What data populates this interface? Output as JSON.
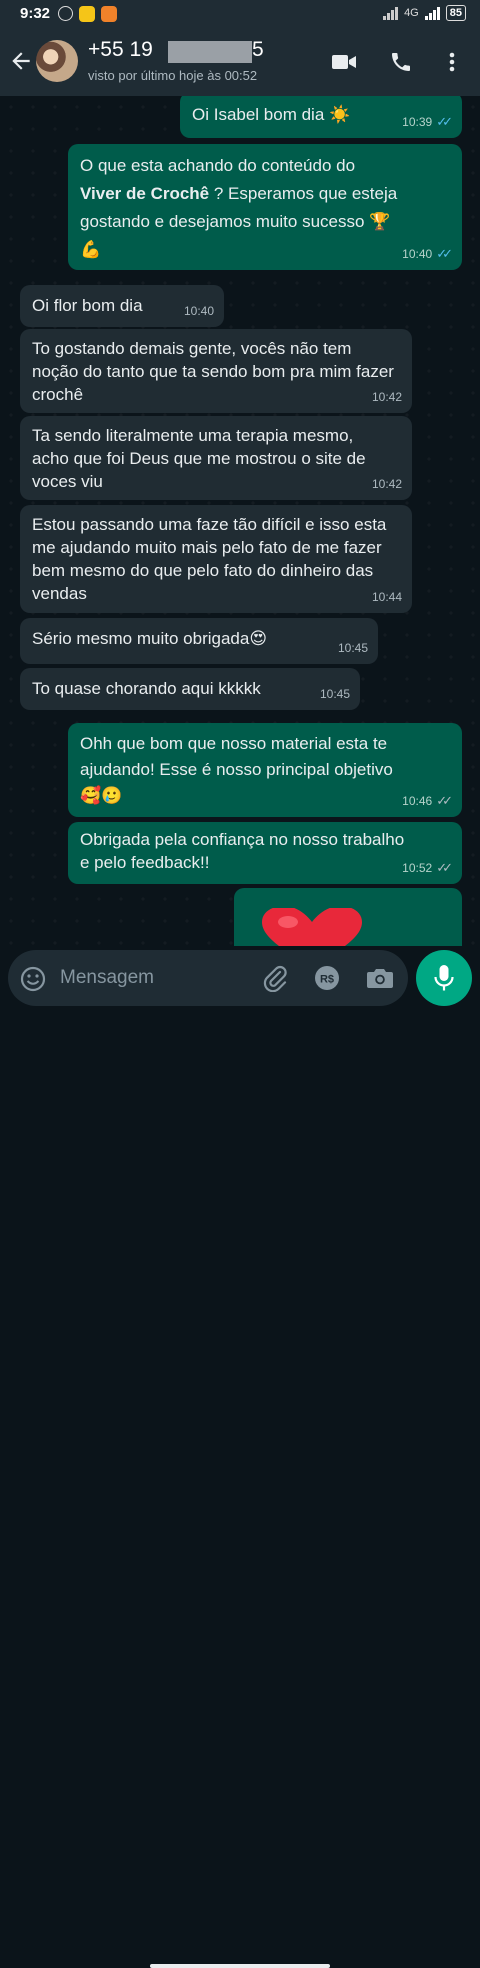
{
  "status_bar": {
    "time": "9:32",
    "battery": "85",
    "network": "4G"
  },
  "header": {
    "contact_name": "+55 19           5665",
    "last_seen": "visto por último hoje às 00:52"
  },
  "messages": [
    {
      "dir": "out",
      "text": "Oi Isabel bom dia ☀️",
      "time": "10:39",
      "ticks": "read"
    },
    {
      "dir": "out",
      "text_pre": "O que esta achando do conteúdo do\n",
      "text_bold": "Viver de Crochê",
      "text_post": " ? Esperamos que esteja gostando e desejamos muito sucesso 🏆\n💪",
      "time": "10:40",
      "ticks": "read"
    },
    {
      "dir": "in",
      "text": "Oi flor bom dia",
      "time": "10:40"
    },
    {
      "dir": "in",
      "text": "To gostando demais gente, vocês não tem noção do tanto que ta sendo bom pra mim fazer crochê",
      "time": "10:42"
    },
    {
      "dir": "in",
      "text": "Ta sendo literalmente uma terapia mesmo, acho que foi Deus que me mostrou o site de voces viu",
      "time": "10:42"
    },
    {
      "dir": "in",
      "text": "Estou passando uma faze tão difícil e isso esta me ajudando muito mais pelo fato de me fazer bem mesmo do que pelo fato do dinheiro das vendas",
      "time": "10:44"
    },
    {
      "dir": "in",
      "text": "Sério mesmo muito obrigada😍",
      "time": "10:45"
    },
    {
      "dir": "in",
      "text": "To quase chorando aqui kkkkk",
      "time": "10:45"
    },
    {
      "dir": "out",
      "text": "Ohh que bom que nosso material esta te ajudando! Esse é nosso principal objetivo\n🥰🥲",
      "time": "10:46",
      "ticks": "delivered"
    },
    {
      "dir": "out",
      "text": "Obrigada pela confiança no nosso trabalho e pelo feedback!!",
      "time": "10:52",
      "ticks": "delivered"
    },
    {
      "dir": "out",
      "text": "❤️",
      "time": "",
      "ticks": ""
    }
  ],
  "input": {
    "placeholder": "Mensagem"
  },
  "icons": [
    "back-arrow-icon",
    "video-call-icon",
    "phone-icon",
    "more-options-icon",
    "emoji-icon",
    "attach-icon",
    "payment-icon",
    "camera-icon",
    "mic-icon"
  ],
  "colors": {
    "outgoing": "#005c4b",
    "incoming": "#202c33",
    "accent": "#00a884",
    "read_ticks": "#53bdeb"
  }
}
